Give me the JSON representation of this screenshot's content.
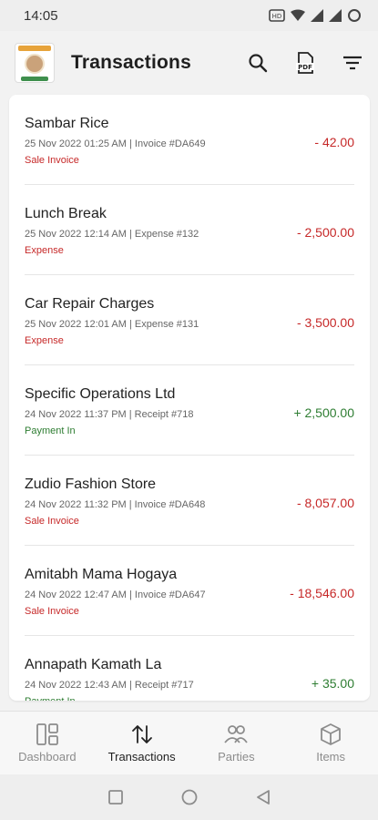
{
  "status_bar": {
    "time": "14:05"
  },
  "header": {
    "title": "Transactions"
  },
  "transactions": [
    {
      "name": "Sambar Rice",
      "date": "25 Nov 2022 01:25 AM",
      "ref": "| Invoice #DA649",
      "type": "Sale Invoice",
      "amount": "- 42.00",
      "direction": "negative"
    },
    {
      "name": "Lunch Break",
      "date": "25 Nov 2022 12:14 AM",
      "ref": "| Expense #132",
      "type": "Expense",
      "amount": "- 2,500.00",
      "direction": "negative"
    },
    {
      "name": "Car Repair Charges",
      "date": "25 Nov 2022 12:01 AM",
      "ref": "| Expense #131",
      "type": "Expense",
      "amount": "- 3,500.00",
      "direction": "negative"
    },
    {
      "name": "Specific Operations Ltd",
      "date": "24 Nov 2022 11:37 PM",
      "ref": "| Receipt #718",
      "type": "Payment In",
      "amount": "+ 2,500.00",
      "direction": "positive"
    },
    {
      "name": "Zudio Fashion Store",
      "date": "24 Nov 2022 11:32 PM",
      "ref": "| Invoice #DA648",
      "type": "Sale Invoice",
      "amount": "- 8,057.00",
      "direction": "negative"
    },
    {
      "name": "Amitabh Mama Hogaya",
      "date": "24 Nov 2022 12:47 AM",
      "ref": "| Invoice #DA647",
      "type": "Sale Invoice",
      "amount": "- 18,546.00",
      "direction": "negative"
    },
    {
      "name": "Annapath Kamath La",
      "date": "24 Nov 2022 12:43 AM",
      "ref": "| Receipt #717",
      "type": "Payment In",
      "amount": "+ 35.00",
      "direction": "positive"
    }
  ],
  "colors": {
    "negative": "#c62828",
    "positive": "#2e7d32",
    "sale_invoice": "#c62828",
    "expense": "#c62828",
    "payment_in": "#2e7d32"
  },
  "bottom_nav": [
    {
      "label": "Dashboard",
      "icon": "dashboard-icon",
      "active": false
    },
    {
      "label": "Transactions",
      "icon": "transactions-icon",
      "active": true
    },
    {
      "label": "Parties",
      "icon": "parties-icon",
      "active": false
    },
    {
      "label": "Items",
      "icon": "items-icon",
      "active": false
    }
  ]
}
